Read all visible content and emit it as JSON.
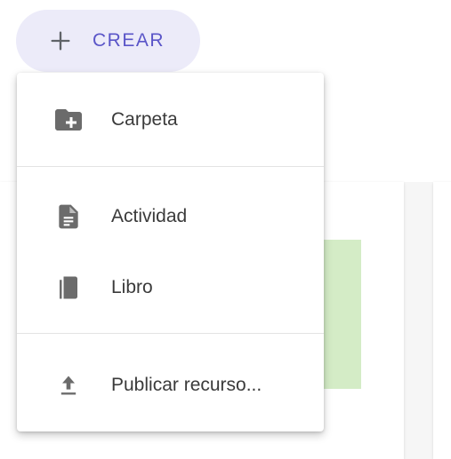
{
  "create_button": {
    "label": "CREAR",
    "accent_color": "#5a55c8",
    "background_color": "#ecebf9",
    "icon": "plus-icon"
  },
  "menu": {
    "items": [
      {
        "label": "Carpeta",
        "icon": "folder-add-icon"
      },
      {
        "label": "Actividad",
        "icon": "document-icon"
      },
      {
        "label": "Libro",
        "icon": "book-icon"
      },
      {
        "label": "Publicar recurso...",
        "icon": "upload-icon"
      }
    ]
  }
}
